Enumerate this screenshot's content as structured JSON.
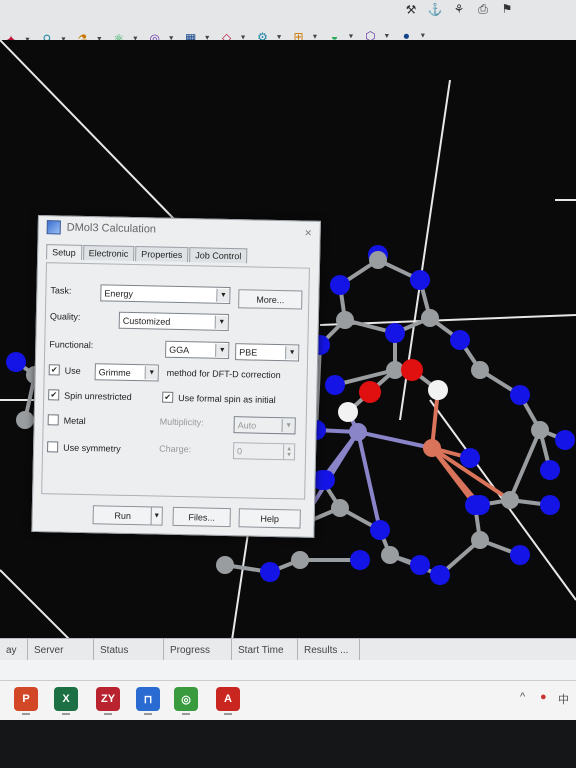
{
  "toolbar": {
    "buttons": [
      {
        "icon": "atom-icon"
      },
      {
        "icon": "bond-icon"
      },
      {
        "icon": "fragment-icon"
      },
      {
        "icon": "molecule-icon"
      },
      {
        "icon": "ring-icon"
      },
      {
        "icon": "grid-icon"
      },
      {
        "icon": "crystal-icon"
      },
      {
        "icon": "gear-icon"
      },
      {
        "icon": "network-icon"
      },
      {
        "icon": "surface-icon"
      },
      {
        "icon": "lattice-icon"
      },
      {
        "icon": "sphere-icon"
      }
    ],
    "top_buttons": [
      {
        "icon": "tool-icon"
      },
      {
        "icon": "tool-icon"
      },
      {
        "icon": "tool-icon"
      },
      {
        "icon": "print-icon"
      },
      {
        "icon": "tool-icon"
      }
    ]
  },
  "dialog": {
    "title": "DMol3 Calculation",
    "close": "×",
    "tabs": [
      "Setup",
      "Electronic",
      "Properties",
      "Job Control"
    ],
    "task": {
      "label": "Task:",
      "value": "Energy",
      "more": "More..."
    },
    "quality": {
      "label": "Quality:",
      "value": "Customized"
    },
    "functional": {
      "label": "Functional:",
      "type": "GGA",
      "value": "PBE"
    },
    "dispersion": {
      "check_label": "Use",
      "checked": true,
      "method": "Grimme",
      "suffix": "method for DFT-D correction"
    },
    "spin": {
      "label": "Spin unrestricted",
      "checked": true,
      "formal_label": "Use formal spin as initial",
      "formal_checked": true
    },
    "metal": {
      "label": "Metal",
      "checked": false,
      "multiplicity_label": "Multiplicity:",
      "multiplicity_value": "Auto"
    },
    "symmetry": {
      "label": "Use symmetry",
      "checked": false,
      "charge_label": "Charge:",
      "charge_value": "0"
    },
    "buttons": {
      "run": "Run",
      "files": "Files...",
      "help": "Help"
    }
  },
  "jobs": {
    "columns": [
      "ay",
      "Server",
      "Status",
      "Progress",
      "Start Time",
      "Results ..."
    ]
  },
  "taskbar": {
    "apps": [
      {
        "name": "powerpoint",
        "glyph": "P",
        "color": "#d24726"
      },
      {
        "name": "excel",
        "glyph": "X",
        "color": "#1d7044"
      },
      {
        "name": "zy",
        "glyph": "ZY",
        "color": "#b8232f"
      },
      {
        "name": "materials-studio",
        "glyph": "⊓",
        "color": "#2a6bd1"
      },
      {
        "name": "photos",
        "glyph": "◎",
        "color": "#3a9a3e"
      },
      {
        "name": "acrobat",
        "glyph": "A",
        "color": "#c8261f"
      }
    ],
    "tray": [
      "^",
      "●",
      "中"
    ]
  },
  "colors": {
    "nitrogen": "#1414e6",
    "carbon": "#9a9da0",
    "oxygen": "#e01010",
    "hydrogen": "#f2f2f2",
    "metal_a": "#8a84c8",
    "metal_b": "#d9735a"
  }
}
